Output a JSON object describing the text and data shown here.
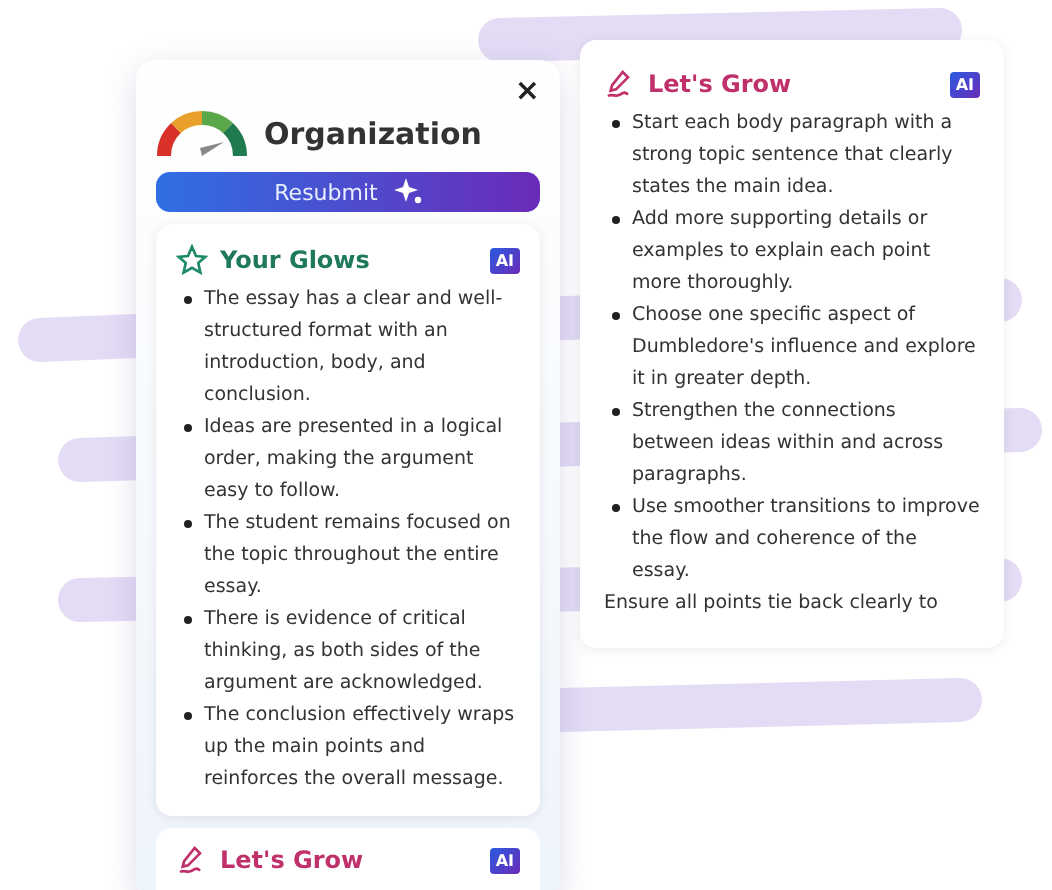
{
  "feedback_panel": {
    "close": "×",
    "title": "Organization",
    "button": "Resubmit"
  },
  "glows": {
    "title": "Your Glows",
    "badge": "AI",
    "items": [
      "The essay has a clear and well-structured format with an introduction, body, and conclusion.",
      "Ideas are presented in a logical order, making the argument easy to follow.",
      "The student remains focused on the topic throughout the entire essay.",
      "There is evidence of critical thinking, as both sides of the argument are acknowledged.",
      "The conclusion effectively wraps up the main points and reinforces the overall message."
    ]
  },
  "next_card": {
    "title": "Let's Grow",
    "badge": "AI"
  },
  "grow": {
    "title": "Let's Grow",
    "badge": "AI",
    "items": [
      {
        "kind": "bullet",
        "text": "Start each body paragraph with a strong topic sentence that clearly states the main idea."
      },
      {
        "kind": "bullet",
        "text": "Add more supporting details or examples to explain each point more thoroughly."
      },
      {
        "kind": "bullet",
        "text": "Choose one specific aspect of Dumbledore's influence and explore it in greater depth."
      },
      {
        "kind": "bullet",
        "text": "Strengthen the connections between ideas within and across paragraphs."
      },
      {
        "kind": "bullet",
        "text": "Use smoother transitions to improve the flow and coherence of the essay."
      },
      {
        "kind": "plain",
        "text": "Ensure all points tie back clearly to"
      }
    ]
  }
}
